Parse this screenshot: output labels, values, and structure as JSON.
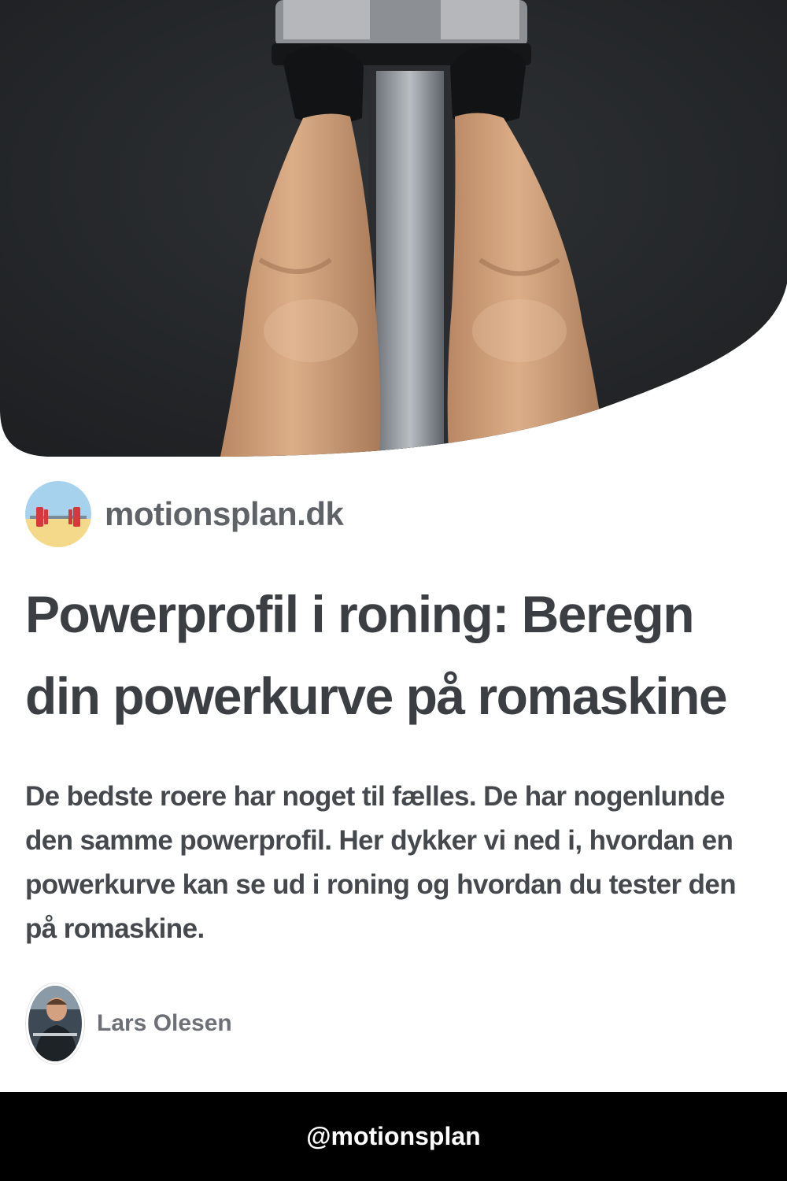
{
  "hero": {
    "image": "rowing-machine-legs-photo"
  },
  "brand": {
    "name": "motionsplan.dk",
    "logo_icon": "barbell-beach-icon"
  },
  "article": {
    "title": "Powerprofil i roning: Beregn din powerkurve på romaskine",
    "summary": "De bedste roere har noget til fælles. De har nogenlunde den samme powerprofil. Her dykker vi ned i, hvordan en powerkurve kan se ud i roning og hvordan du tester den på romaskine."
  },
  "author": {
    "name": "Lars Olesen",
    "avatar": "author-portrait-photo"
  },
  "footer": {
    "handle": "@motionsplan"
  }
}
